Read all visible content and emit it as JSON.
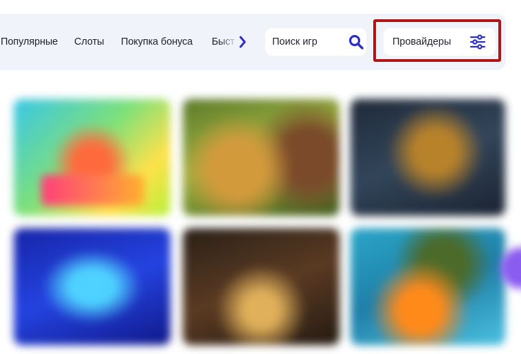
{
  "nav": {
    "tabs": [
      {
        "label": "Популярные"
      },
      {
        "label": "Слоты"
      },
      {
        "label": "Покупка бонуса"
      },
      {
        "label": "Быст"
      }
    ],
    "next_icon": "chevron-right-icon"
  },
  "search": {
    "placeholder": "Поиск игр",
    "icon": "search-icon"
  },
  "providers": {
    "label": "Провайдеры",
    "icon": "sliders-icon",
    "highlight_color": "#b01516"
  },
  "colors": {
    "accent": "#2b2fc7",
    "bar_bg": "#f1f3fb",
    "text": "#1d1f2b"
  },
  "games": [
    {
      "id": "game-1"
    },
    {
      "id": "game-2"
    },
    {
      "id": "game-3"
    },
    {
      "id": "game-4"
    },
    {
      "id": "game-5"
    },
    {
      "id": "game-6"
    }
  ]
}
